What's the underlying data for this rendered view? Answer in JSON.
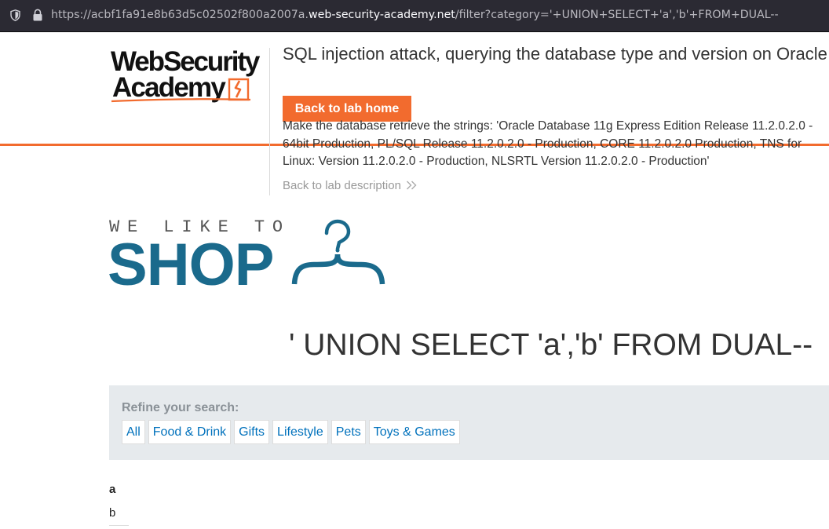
{
  "browser": {
    "url_prefix": "https://acbf1fa91e8b63d5c02502f800a2007a.",
    "url_host": "web-security-academy.net",
    "url_suffix": "/filter?category='+UNION+SELECT+'a','b'+FROM+DUAL--"
  },
  "academy": {
    "logo_line1": "WebSecurity",
    "logo_line2": "Academy",
    "lab_title": "SQL injection attack, querying the database type and version on Oracle",
    "back_button": "Back to lab home",
    "description": "Make the database retrieve the strings: 'Oracle Database 11g Express Edition Release 11.2.0.2.0 - 64bit Production, PL/SQL Release 11.2.0.2.0 - Production, CORE 11.2.0.2.0 Production, TNS for Linux: Version 11.2.0.2.0 - Production, NLSRTL Version 11.2.0.2.0 - Production'",
    "back_to_description": "Back to lab description"
  },
  "shop": {
    "logo_top": "WE LIKE TO",
    "logo_big": "SHOP"
  },
  "search_title": "' UNION SELECT 'a','b' FROM DUAL--",
  "refine": {
    "label": "Refine your search:",
    "filters": [
      "All",
      "Food & Drink",
      "Gifts",
      "Lifestyle",
      "Pets",
      "Toys & Games"
    ]
  },
  "results": {
    "header": "a",
    "value": "b"
  },
  "colors": {
    "accent_orange": "#f26b2e",
    "shop_blue": "#1a6a8c",
    "link_blue": "#0071bc"
  }
}
